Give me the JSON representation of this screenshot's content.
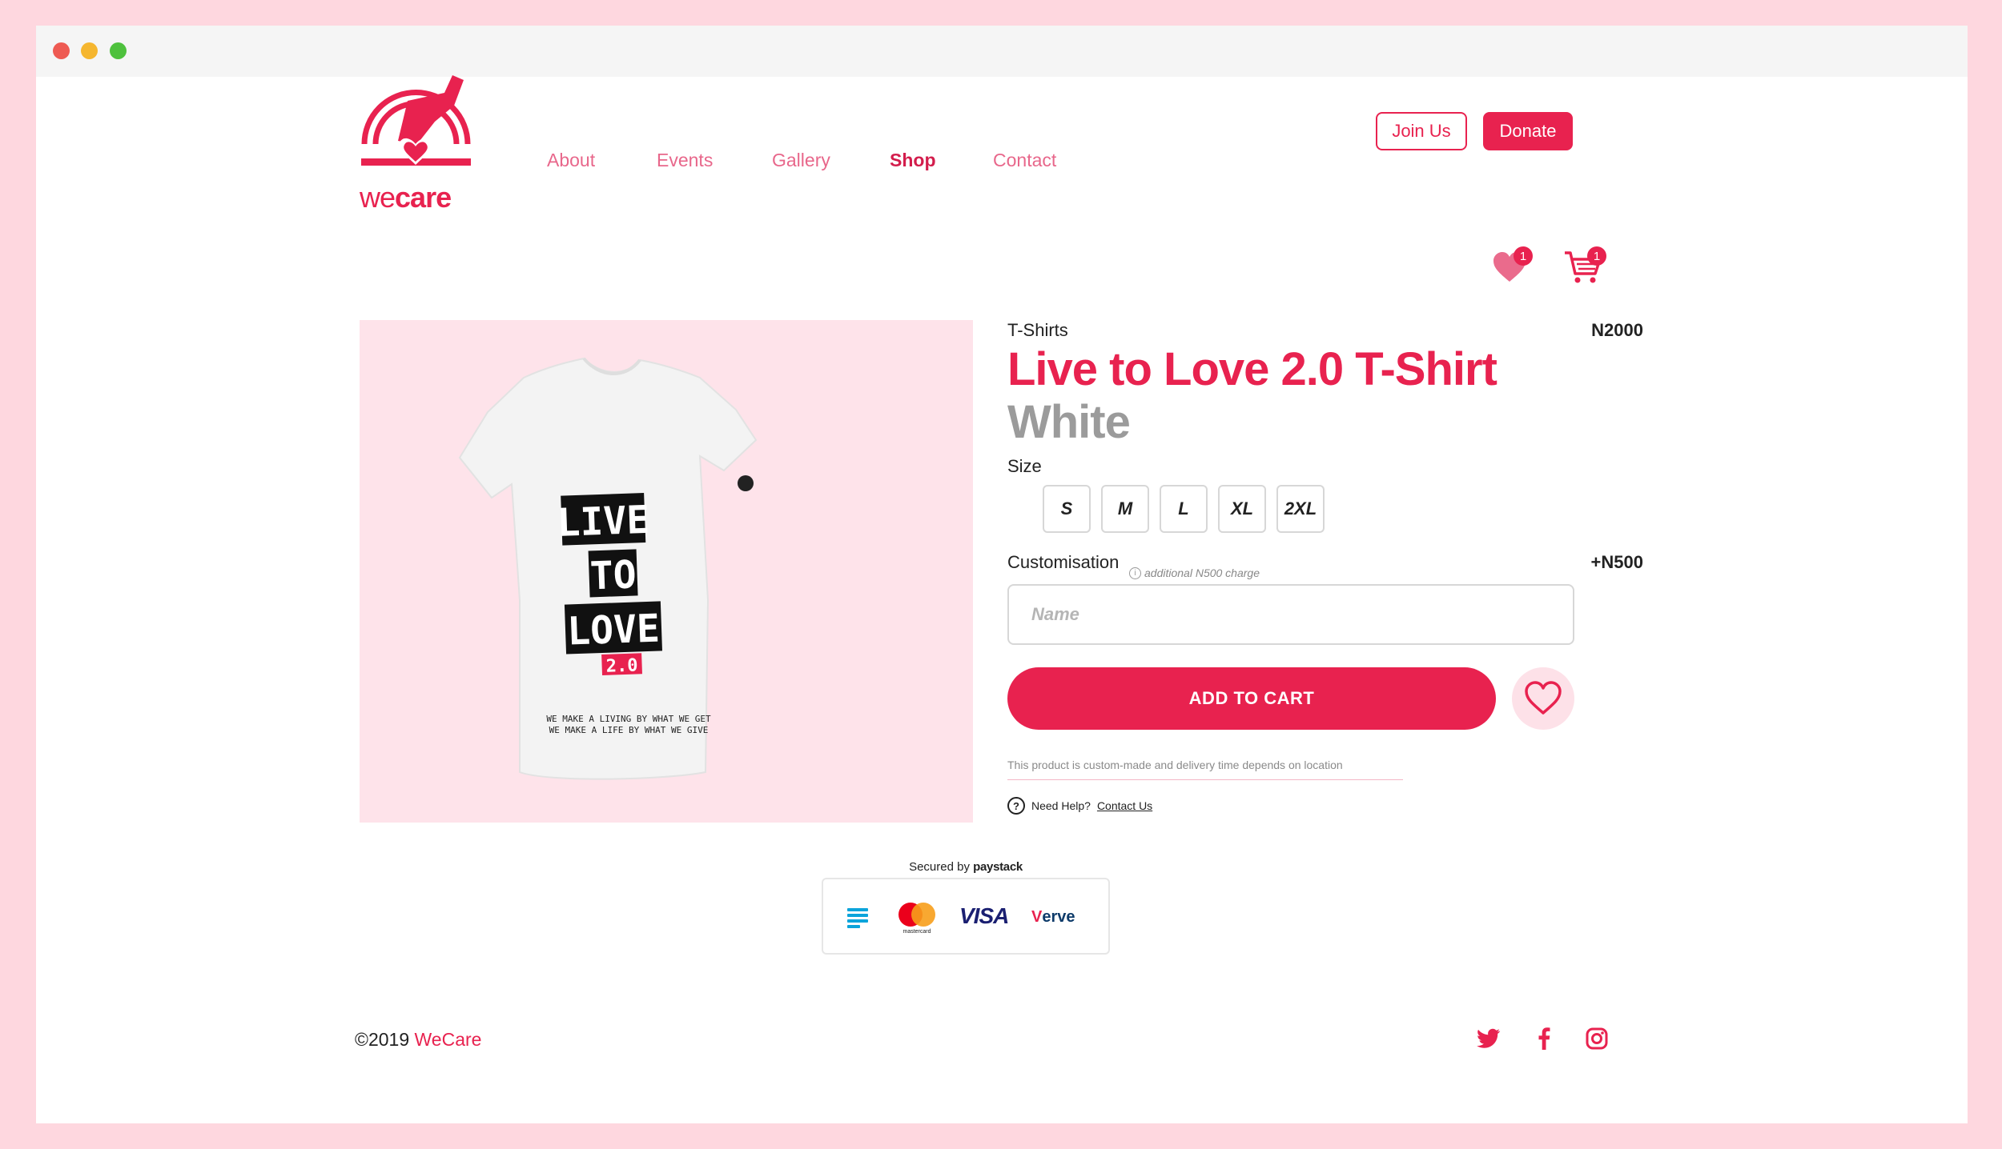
{
  "brand": {
    "logo_text_light": "we",
    "logo_text_bold": "care",
    "accent_color": "#e8224f"
  },
  "nav": {
    "items": [
      "About",
      "Events",
      "Gallery",
      "Shop",
      "Contact"
    ],
    "active": "Shop"
  },
  "header_buttons": {
    "join": "Join Us",
    "donate": "Donate"
  },
  "header_icons": {
    "wishlist_count": "1",
    "cart_count": "1"
  },
  "product": {
    "category": "T-Shirts",
    "price": "N2000",
    "title": "Live to Love 2.0 T-Shirt",
    "color": "White",
    "size_label": "Size",
    "sizes": [
      "S",
      "M",
      "L",
      "XL",
      "2XL"
    ],
    "customisation_label": "Customisation",
    "customisation_note": "additional N500 charge",
    "customisation_price": "+N500",
    "name_placeholder": "Name",
    "add_to_cart": "ADD TO CART",
    "delivery_note": "This product is custom-made and delivery time depends on location",
    "help_text": "Need Help?",
    "help_link": "Contact Us"
  },
  "shirt_print": {
    "line1": "LIVE",
    "line2": "TO",
    "line3": "LOVE",
    "version": "2.0",
    "tagline1": "WE MAKE A LIVING BY WHAT WE GET",
    "tagline2": "WE MAKE A LIFE BY WHAT WE GIVE"
  },
  "payment": {
    "secured_prefix": "Secured by",
    "provider": "paystack",
    "cards": [
      "mastercard",
      "VISA",
      "Verve"
    ],
    "verve_first": "V",
    "verve_rest": "erve"
  },
  "footer": {
    "copyright_prefix": "©2019",
    "copyright_brand": "WeCare"
  }
}
